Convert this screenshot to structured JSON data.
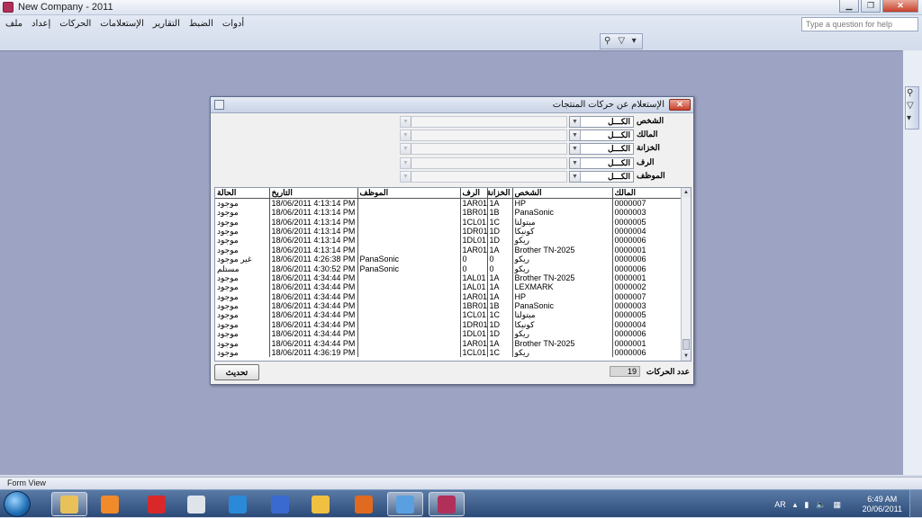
{
  "window": {
    "title": "New Company - 2011"
  },
  "menu": [
    "ملف",
    "إعداد",
    "الحركات",
    "الإستعلامات",
    "التقارير",
    "الضبط",
    "أدوات"
  ],
  "help": {
    "placeholder": "Type a question for help"
  },
  "dialog": {
    "title": "الإستعلام عن حركات المنتجات",
    "filters": [
      {
        "label": "الشخص",
        "value": "الكـــل"
      },
      {
        "label": "المالك",
        "value": "الكـــل"
      },
      {
        "label": "الخزانة",
        "value": "الكـــل"
      },
      {
        "label": "الرف",
        "value": "الكـــل"
      },
      {
        "label": "الموظف",
        "value": "الكـــل"
      }
    ],
    "columns": [
      "الحالة",
      "التاريخ",
      "الموظف",
      "الرف",
      "الخزانة",
      "الشخص",
      "المالك"
    ],
    "rows": [
      [
        "موجود",
        "18/06/2011 4:13:14 PM",
        "",
        "1AR01",
        "1A",
        "HP",
        "0000007"
      ],
      [
        "موجود",
        "18/06/2011 4:13:14 PM",
        "",
        "1BR01",
        "1B",
        "PanaSonic",
        "0000003"
      ],
      [
        "موجود",
        "18/06/2011 4:13:14 PM",
        "",
        "1CL01",
        "1C",
        "ميتولتا",
        "0000005"
      ],
      [
        "موجود",
        "18/06/2011 4:13:14 PM",
        "",
        "1DR01",
        "1D",
        "كونيكا",
        "0000004"
      ],
      [
        "موجود",
        "18/06/2011 4:13:14 PM",
        "",
        "1DL01",
        "1D",
        "ريكو",
        "0000006"
      ],
      [
        "موجود",
        "18/06/2011 4:13:14 PM",
        "",
        "1AR01",
        "1A",
        "Brother TN-2025",
        "0000001"
      ],
      [
        "غير موجود",
        "18/06/2011 4:26:38 PM",
        "PanaSonic",
        "0",
        "0",
        "ريكو",
        "0000006"
      ],
      [
        "مستلم",
        "18/06/2011 4:30:52 PM",
        "PanaSonic",
        "0",
        "0",
        "ريكو",
        "0000006"
      ],
      [
        "موجود",
        "18/06/2011 4:34:44 PM",
        "",
        "1AL01",
        "1A",
        "Brother TN-2025",
        "0000001"
      ],
      [
        "موجود",
        "18/06/2011 4:34:44 PM",
        "",
        "1AL01",
        "1A",
        "LEXMARK",
        "0000002"
      ],
      [
        "موجود",
        "18/06/2011 4:34:44 PM",
        "",
        "1AR01",
        "1A",
        "HP",
        "0000007"
      ],
      [
        "موجود",
        "18/06/2011 4:34:44 PM",
        "",
        "1BR01",
        "1B",
        "PanaSonic",
        "0000003"
      ],
      [
        "موجود",
        "18/06/2011 4:34:44 PM",
        "",
        "1CL01",
        "1C",
        "ميتولتا",
        "0000005"
      ],
      [
        "موجود",
        "18/06/2011 4:34:44 PM",
        "",
        "1DR01",
        "1D",
        "كونيكا",
        "0000004"
      ],
      [
        "موجود",
        "18/06/2011 4:34:44 PM",
        "",
        "1DL01",
        "1D",
        "ريكو",
        "0000006"
      ],
      [
        "موجود",
        "18/06/2011 4:34:44 PM",
        "",
        "1AR01",
        "1A",
        "Brother TN-2025",
        "0000001"
      ],
      [
        "موجود",
        "18/06/2011 4:36:19 PM",
        "",
        "1CL01",
        "1C",
        "ريكو",
        "0000006"
      ]
    ],
    "update_label": "تحديث",
    "count_label": "عدد الحركات",
    "count_value": "19"
  },
  "status": {
    "text": "Form View"
  },
  "taskbar": {
    "lang": "AR",
    "time": "6:49 AM",
    "date": "20/06/2011",
    "apps": [
      {
        "name": "explorer-icon",
        "color": "#e8c15a"
      },
      {
        "name": "media-player-icon",
        "color": "#f08a2a"
      },
      {
        "name": "paint-icon",
        "color": "#d8282a"
      },
      {
        "name": "clock-app-icon",
        "color": "#dfe4ea"
      },
      {
        "name": "internet-explorer-icon",
        "color": "#2a8ad8"
      },
      {
        "name": "messenger-icon",
        "color": "#3a6ad0"
      },
      {
        "name": "mail-icon",
        "color": "#f0c040"
      },
      {
        "name": "firefox-icon",
        "color": "#e06a20"
      },
      {
        "name": "users-app-icon",
        "color": "#5aa0e0"
      },
      {
        "name": "access-app-icon",
        "color": "#b1305a"
      }
    ]
  },
  "colors": {
    "accent": "#b1305a",
    "workspace": "#9ca3c3"
  }
}
